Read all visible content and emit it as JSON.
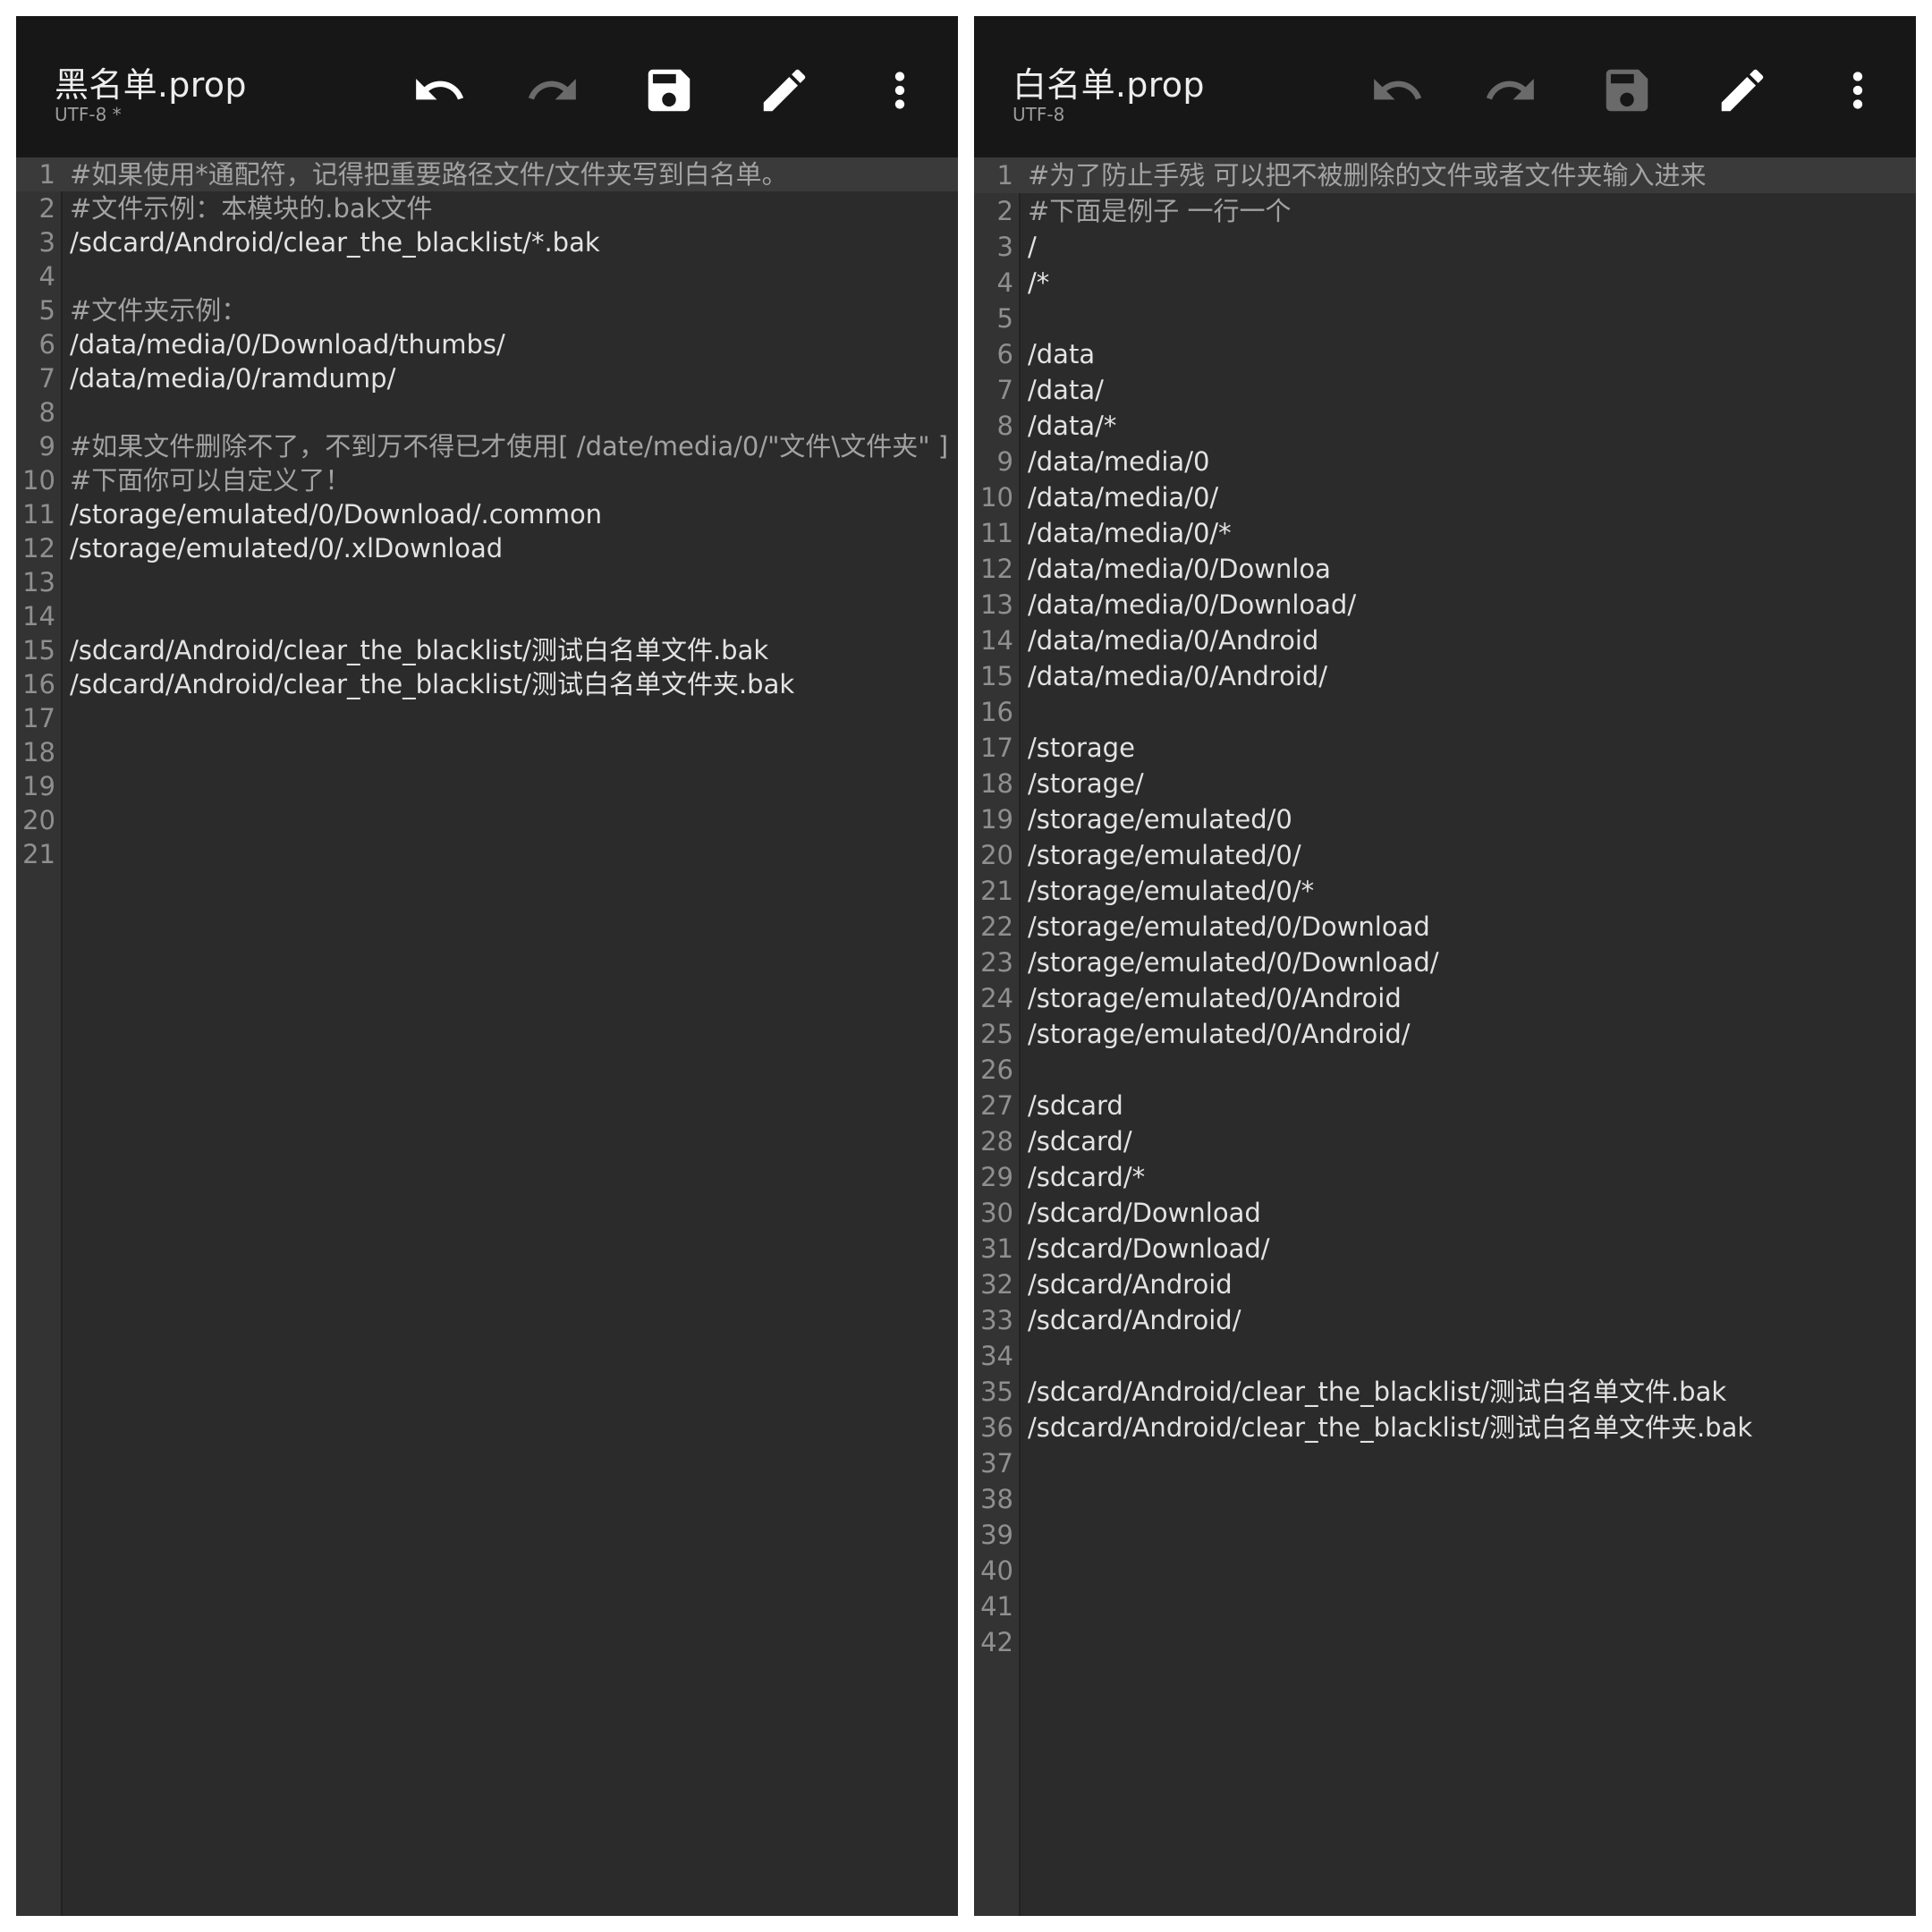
{
  "left": {
    "title": "黑名单.prop",
    "encoding": "UTF-8 *",
    "toolbar": {
      "undo": {
        "icon": "undo-icon",
        "enabled": true
      },
      "redo": {
        "icon": "redo-icon",
        "enabled": false
      },
      "save": {
        "icon": "save-icon",
        "enabled": true
      },
      "edit": {
        "icon": "pencil-icon",
        "enabled": true
      },
      "more": {
        "icon": "more-vert-icon",
        "enabled": true
      }
    },
    "lines": [
      {
        "n": "1",
        "text": "#如果使用*通配符，记得把重要路径文件/文件夹写到白名单。"
      },
      {
        "n": "2",
        "text": "#文件示例：本模块的.bak文件"
      },
      {
        "n": "3",
        "text": "/sdcard/Android/clear_the_blacklist/*.bak"
      },
      {
        "n": "4",
        "text": ""
      },
      {
        "n": "5",
        "text": "#文件夹示例："
      },
      {
        "n": "6",
        "text": "/data/media/0/Download/thumbs/"
      },
      {
        "n": "7",
        "text": "/data/media/0/ramdump/"
      },
      {
        "n": "8",
        "text": ""
      },
      {
        "n": "9",
        "text": "#如果文件删除不了，不到万不得已才使用[ /date/media/0/\"文件\\文件夹\" ]"
      },
      {
        "n": "10",
        "text": "#下面你可以自定义了！"
      },
      {
        "n": "11",
        "text": "/storage/emulated/0/Download/.common"
      },
      {
        "n": "12",
        "text": "/storage/emulated/0/.xlDownload"
      },
      {
        "n": "13",
        "text": ""
      },
      {
        "n": "14",
        "text": ""
      },
      {
        "n": "15",
        "text": "/sdcard/Android/clear_the_blacklist/测试白名单文件.bak"
      },
      {
        "n": "16",
        "text": "/sdcard/Android/clear_the_blacklist/测试白名单文件夹.bak"
      },
      {
        "n": "17",
        "text": ""
      },
      {
        "n": "18",
        "text": ""
      },
      {
        "n": "19",
        "text": ""
      },
      {
        "n": "20",
        "text": ""
      },
      {
        "n": "21",
        "text": ""
      }
    ]
  },
  "right": {
    "title": "白名单.prop",
    "encoding": "UTF-8",
    "toolbar": {
      "undo": {
        "icon": "undo-icon",
        "enabled": false
      },
      "redo": {
        "icon": "redo-icon",
        "enabled": false
      },
      "save": {
        "icon": "save-icon",
        "enabled": false
      },
      "edit": {
        "icon": "pencil-icon",
        "enabled": true
      },
      "more": {
        "icon": "more-vert-icon",
        "enabled": true
      }
    },
    "lines": [
      {
        "n": "1",
        "text": "#为了防止手残 可以把不被删除的文件或者文件夹输入进来"
      },
      {
        "n": "2",
        "text": "#下面是例子 一行一个"
      },
      {
        "n": "3",
        "text": "/"
      },
      {
        "n": "4",
        "text": "/*"
      },
      {
        "n": "5",
        "text": ""
      },
      {
        "n": "6",
        "text": "/data"
      },
      {
        "n": "7",
        "text": "/data/"
      },
      {
        "n": "8",
        "text": "/data/*"
      },
      {
        "n": "9",
        "text": "/data/media/0"
      },
      {
        "n": "10",
        "text": "/data/media/0/"
      },
      {
        "n": "11",
        "text": "/data/media/0/*"
      },
      {
        "n": "12",
        "text": "/data/media/0/Downloa"
      },
      {
        "n": "13",
        "text": "/data/media/0/Download/"
      },
      {
        "n": "14",
        "text": "/data/media/0/Android"
      },
      {
        "n": "15",
        "text": "/data/media/0/Android/"
      },
      {
        "n": "16",
        "text": ""
      },
      {
        "n": "17",
        "text": "/storage"
      },
      {
        "n": "18",
        "text": "/storage/"
      },
      {
        "n": "19",
        "text": "/storage/emulated/0"
      },
      {
        "n": "20",
        "text": "/storage/emulated/0/"
      },
      {
        "n": "21",
        "text": "/storage/emulated/0/*"
      },
      {
        "n": "22",
        "text": "/storage/emulated/0/Download"
      },
      {
        "n": "23",
        "text": "/storage/emulated/0/Download/"
      },
      {
        "n": "24",
        "text": "/storage/emulated/0/Android"
      },
      {
        "n": "25",
        "text": "/storage/emulated/0/Android/"
      },
      {
        "n": "26",
        "text": ""
      },
      {
        "n": "27",
        "text": "/sdcard"
      },
      {
        "n": "28",
        "text": "/sdcard/"
      },
      {
        "n": "29",
        "text": "/sdcard/*"
      },
      {
        "n": "30",
        "text": "/sdcard/Download"
      },
      {
        "n": "31",
        "text": "/sdcard/Download/"
      },
      {
        "n": "32",
        "text": "/sdcard/Android"
      },
      {
        "n": "33",
        "text": "/sdcard/Android/"
      },
      {
        "n": "34",
        "text": ""
      },
      {
        "n": "35",
        "text": "/sdcard/Android/clear_the_blacklist/测试白名单文件.bak"
      },
      {
        "n": "36",
        "text": "/sdcard/Android/clear_the_blacklist/测试白名单文件夹.bak"
      },
      {
        "n": "37",
        "text": ""
      },
      {
        "n": "38",
        "text": ""
      },
      {
        "n": "39",
        "text": ""
      },
      {
        "n": "40",
        "text": ""
      },
      {
        "n": "41",
        "text": ""
      },
      {
        "n": "42",
        "text": ""
      }
    ]
  },
  "colors": {
    "toolbar_bg": "#171717",
    "editor_bg": "#2b2b2b",
    "gutter_bg": "#333333",
    "current_line_bg": "#3a3a3a",
    "text": "#e3e3e3",
    "comment": "#a2a2a2",
    "line_number": "#8f8f8f",
    "icon_enabled": "#ffffff",
    "icon_disabled": "#6a6a6a"
  }
}
